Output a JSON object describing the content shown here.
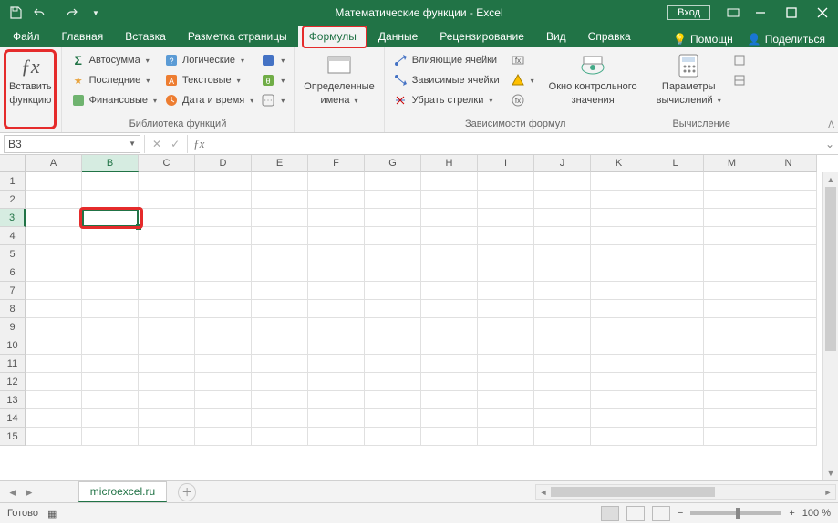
{
  "titlebar": {
    "title": "Математические функции  -  Excel",
    "signin": "Вход"
  },
  "tabs": {
    "items": [
      "Файл",
      "Главная",
      "Вставка",
      "Разметка страницы",
      "Формулы",
      "Данные",
      "Рецензирование",
      "Вид",
      "Справка"
    ],
    "active_index": 4,
    "help": "Помощн",
    "share": "Поделиться"
  },
  "ribbon": {
    "insert_fn": {
      "label_l1": "Вставить",
      "label_l2": "функцию"
    },
    "lib": {
      "autosum": "Автосумма",
      "recent": "Последние",
      "financial": "Финансовые",
      "logical": "Логические",
      "text": "Текстовые",
      "date": "Дата и время",
      "label": "Библиотека функций"
    },
    "names": {
      "btn_l1": "Определенные",
      "btn_l2": "имена"
    },
    "audit": {
      "trace_prec": "Влияющие ячейки",
      "trace_dep": "Зависимые ячейки",
      "remove_arrows": "Убрать стрелки",
      "watch_l1": "Окно контрольного",
      "watch_l2": "значения",
      "label": "Зависимости формул"
    },
    "calc": {
      "options_l1": "Параметры",
      "options_l2": "вычислений",
      "label": "Вычисление"
    }
  },
  "namebox": {
    "value": "B3"
  },
  "grid": {
    "cols": [
      "A",
      "B",
      "C",
      "D",
      "E",
      "F",
      "G",
      "H",
      "I",
      "J",
      "K",
      "L",
      "M",
      "N"
    ],
    "rows": [
      "1",
      "2",
      "3",
      "4",
      "5",
      "6",
      "7",
      "8",
      "9",
      "10",
      "11",
      "12",
      "13",
      "14",
      "15"
    ],
    "selected_col": 1,
    "selected_row": 2
  },
  "sheets": {
    "active": "microexcel.ru"
  },
  "status": {
    "ready": "Готово",
    "zoom": "100 %"
  }
}
